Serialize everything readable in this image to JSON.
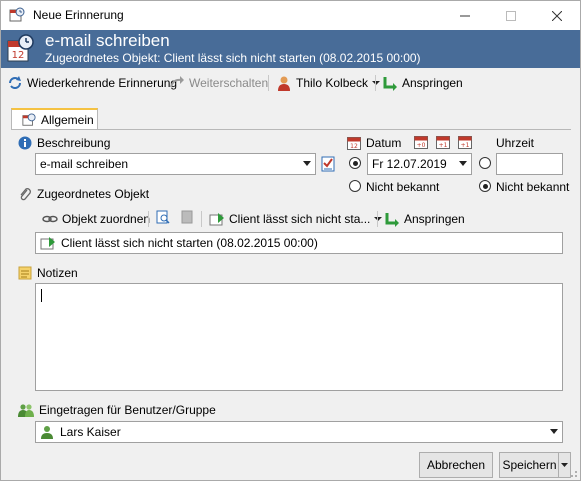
{
  "window": {
    "title": "Neue Erinnerung"
  },
  "header": {
    "title": "e-mail schreiben",
    "subtitle": "Zugeordnetes Objekt: Client lässt sich nicht starten (08.02.2015 00:00)"
  },
  "toolbar": {
    "recurring": "Wiederkehrende Erinnerung",
    "forward": "Weiterschalten",
    "user": "Thilo Kolbeck",
    "jump": "Anspringen"
  },
  "tabs": [
    {
      "label": "Allgemein"
    }
  ],
  "form": {
    "description_label": "Beschreibung",
    "description_value": "e-mail schreiben",
    "date_label": "Datum",
    "date_value": "Fr 12.07.2019",
    "date_unknown": "Nicht bekannt",
    "time_label": "Uhrzeit",
    "time_value": "",
    "time_unknown": "Nicht bekannt",
    "assigned_label": "Zugeordnetes Objekt",
    "assign_object": "Objekt zuordnen",
    "object_dropdown": "Client lässt sich nicht sta...",
    "jump": "Anspringen",
    "assigned_value": "Client lässt sich nicht starten (08.02.2015 00:00)",
    "notes_label": "Notizen",
    "notes_value": "",
    "user_label": "Eingetragen für Benutzer/Gruppe",
    "user_value": "Lars Kaiser"
  },
  "footer": {
    "cancel": "Abbrechen",
    "save": "Speichern"
  },
  "colors": {
    "header_bg": "#486c98",
    "tab_accent": "#f5c242"
  }
}
